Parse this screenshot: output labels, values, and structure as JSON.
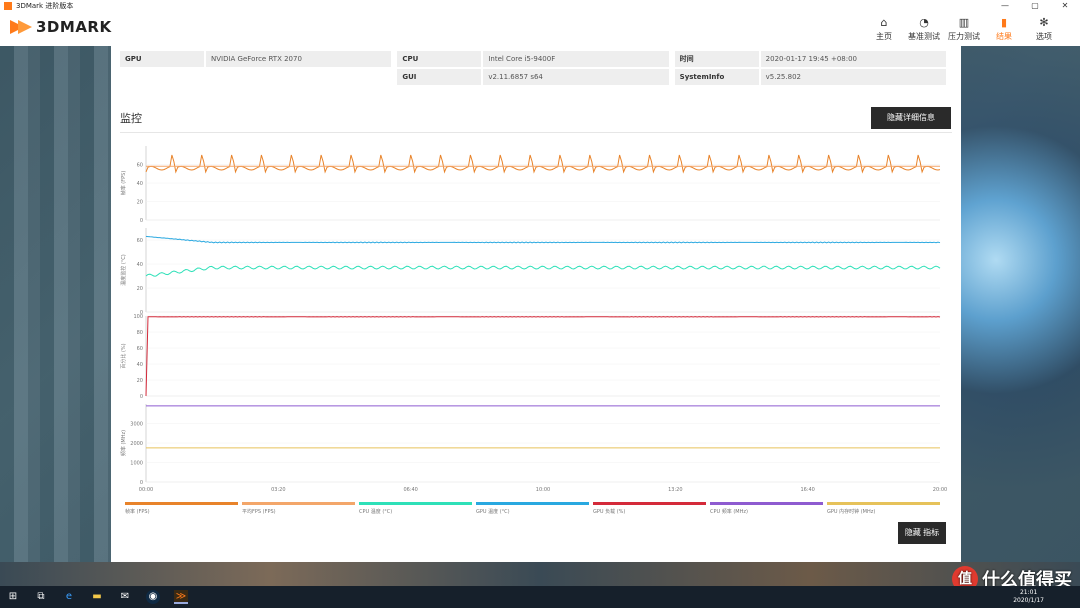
{
  "window": {
    "title": "3DMark 进阶版本",
    "controls": [
      "—",
      "▢",
      "✕"
    ]
  },
  "nav": {
    "logo": "3DMARK",
    "items": [
      {
        "label": "主页",
        "icon": "home-icon",
        "glyph": "⌂"
      },
      {
        "label": "基准测试",
        "icon": "gauge-icon",
        "glyph": "◔"
      },
      {
        "label": "压力测试",
        "icon": "stress-bars-icon",
        "glyph": "▥"
      },
      {
        "label": "结果",
        "icon": "results-bars-icon",
        "glyph": "▮"
      },
      {
        "label": "选项",
        "icon": "gear-icon",
        "glyph": "✻"
      }
    ],
    "active": "结果",
    "accent": "#ff7a1a"
  },
  "info": {
    "rows": [
      [
        {
          "k": "GPU",
          "v": "NVIDIA GeForce RTX 2070"
        },
        {
          "k": "CPU",
          "v": "Intel Core i5-9400F"
        },
        {
          "k": "时间",
          "v": "2020-01-17 19:45 +08:00"
        }
      ],
      [
        {
          "k": "",
          "v": ""
        },
        {
          "k": "GUI",
          "v": "v2.11.6857 s64"
        },
        {
          "k": "SystemInfo",
          "v": "v5.25.802"
        }
      ]
    ]
  },
  "monitor": {
    "title": "监控",
    "hide_details_label": "隐藏详细信息",
    "hide_metrics_label": "隐藏 指标"
  },
  "chart_data": {
    "type": "line",
    "x_ticks": [
      "00:00",
      "03:20",
      "06:40",
      "10:00",
      "13:20",
      "16:40",
      "20:00"
    ],
    "xlim_seconds": [
      0,
      1200
    ],
    "panels": [
      {
        "ylabel": "帧率 (FPS)",
        "yticks": [
          "0",
          "20",
          "40",
          "60"
        ],
        "ylim": [
          0,
          80
        ],
        "series": [
          {
            "name": "帧率 (FPS)",
            "color": "#e8832a",
            "values_desc": "oscillating",
            "base": 56,
            "peak": 72,
            "period_s": 30
          },
          {
            "name": "平均FPS (FPS)",
            "color": "#f3a66a",
            "constant": 58
          }
        ]
      },
      {
        "ylabel": "温度监控 (°C)",
        "yticks": [
          "0",
          "20",
          "40",
          "60"
        ],
        "ylim": [
          0,
          70
        ],
        "series": [
          {
            "name": "GPU 温度 (°C)",
            "color": "#29a8e0",
            "start": 63,
            "steady": 58
          },
          {
            "name": "CPU 温度 (°C)",
            "color": "#2ee0b8",
            "start": 30,
            "steady": 37
          }
        ]
      },
      {
        "ylabel": "百分比 (%)",
        "yticks": [
          "0",
          "20",
          "40",
          "60",
          "80",
          "100"
        ],
        "ylim": [
          0,
          100
        ],
        "series": [
          {
            "name": "GPU 负载 (%)",
            "color": "#d42a3a",
            "start": 0,
            "steady": 99
          }
        ]
      },
      {
        "ylabel": "频率 (MHz)",
        "yticks": [
          "0",
          "1000",
          "2000",
          "3000"
        ],
        "ylim": [
          0,
          4000
        ],
        "series": [
          {
            "name": "CPU 频率 (MHz)",
            "color": "#8e5bd0",
            "constant": 3900
          },
          {
            "name": "GPU 内存时钟 (MHz)",
            "color": "#e6c25a",
            "constant": 1750
          }
        ]
      }
    ],
    "legend": [
      {
        "label": "帧率 (FPS)",
        "color": "#e8832a"
      },
      {
        "label": "平均FPS (FPS)",
        "color": "#f3a66a"
      },
      {
        "label": "CPU 温度 (°C)",
        "color": "#2ee0b8"
      },
      {
        "label": "GPU 温度 (°C)",
        "color": "#29a8e0"
      },
      {
        "label": "GPU 负载 (%)",
        "color": "#d42a3a"
      },
      {
        "label": "CPU 频率 (MHz)",
        "color": "#8e5bd0"
      },
      {
        "label": "GPU 内存时钟 (MHz)",
        "color": "#e6c25a"
      }
    ]
  },
  "taskbar": {
    "time": "21:01",
    "date": "2020/1/17"
  },
  "watermark": {
    "badge": "值",
    "text": "什么值得买"
  }
}
